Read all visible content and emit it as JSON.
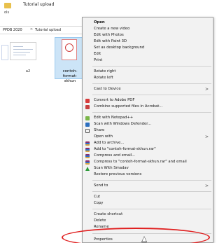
{
  "window": {
    "title": "Tutorial upload",
    "ribbon_fragment": "ols"
  },
  "address": {
    "crumbs": [
      "PPDB 2020",
      "Tutorial upload"
    ],
    "separator": ">"
  },
  "files": [
    {
      "label": "a2"
    },
    {
      "label": "contoh-format-skhun",
      "display": "contoh-format-\nskhun"
    }
  ],
  "context_menu": {
    "items": {
      "open": "Open",
      "new_video": "Create a new video",
      "edit_photos": "Edit with Photos",
      "edit_paint3d": "Edit with Paint 3D",
      "set_desktop_bg": "Set as desktop background",
      "edit": "Edit",
      "print": "Print",
      "rotate_right": "Rotate right",
      "rotate_left": "Rotate left",
      "cast_to_device": "Cast to Device",
      "convert_adobe_pdf": "Convert to Adobe PDF",
      "combine_acrobat": "Combine supported files in Acrobat...",
      "edit_notepadpp": "Edit with Notepad++",
      "scan_defender": "Scan with Windows Defender...",
      "share": "Share",
      "open_with": "Open with",
      "add_to_archive": "Add to archive...",
      "add_to_rar": "Add to \"contoh-format-skhun.rar\"",
      "compress_email": "Compress and email...",
      "compress_rar_email": "Compress to \"contoh-format-skhun.rar\" and email",
      "scan_smadav": "Scan With Smadav",
      "restore_versions": "Restore previous versions",
      "send_to": "Send to",
      "cut": "Cut",
      "copy": "Copy",
      "create_shortcut": "Create shortcut",
      "delete": "Delete",
      "rename": "Rename",
      "properties": "Properties"
    },
    "submenu_arrow": ">"
  },
  "colors": {
    "menu_bg": "#f2f2f2",
    "selection": "#cce4f7",
    "annotation": "#e02020"
  }
}
